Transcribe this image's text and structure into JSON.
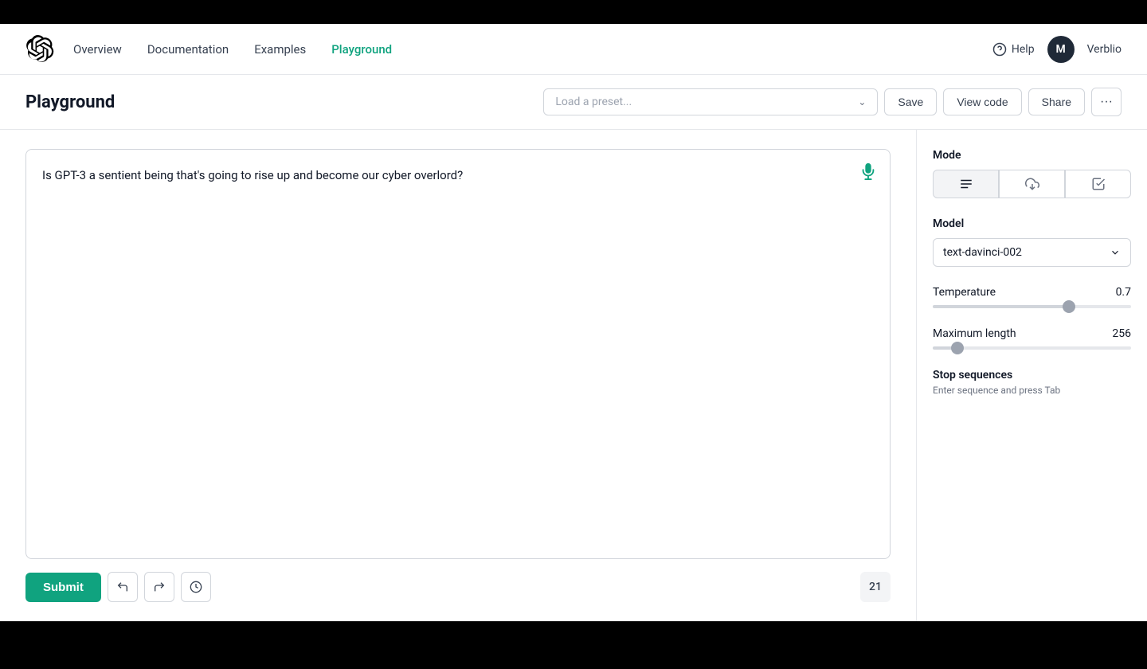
{
  "nav": {
    "links": [
      {
        "label": "Overview",
        "active": false
      },
      {
        "label": "Documentation",
        "active": false
      },
      {
        "label": "Examples",
        "active": false
      },
      {
        "label": "Playground",
        "active": true
      }
    ],
    "help_label": "Help",
    "user_initial": "M",
    "username": "Verblio"
  },
  "header": {
    "title": "Playground",
    "preset_placeholder": "Load a preset...",
    "save_label": "Save",
    "view_code_label": "View code",
    "share_label": "Share",
    "more_label": "···"
  },
  "editor": {
    "prompt_text": "Is GPT-3 a sentient being that's going to rise up and become our cyber overlord?",
    "submit_label": "Submit",
    "token_count": "21"
  },
  "settings": {
    "mode_label": "Mode",
    "model_label": "Model",
    "model_value": "text-davinci-002",
    "temperature_label": "Temperature",
    "temperature_value": "0.7",
    "temperature_slider": 70,
    "max_length_label": "Maximum length",
    "max_length_value": "256",
    "max_length_slider": 10,
    "stop_sequences_label": "Stop sequences",
    "stop_sequences_hint": "Enter sequence and press Tab"
  }
}
